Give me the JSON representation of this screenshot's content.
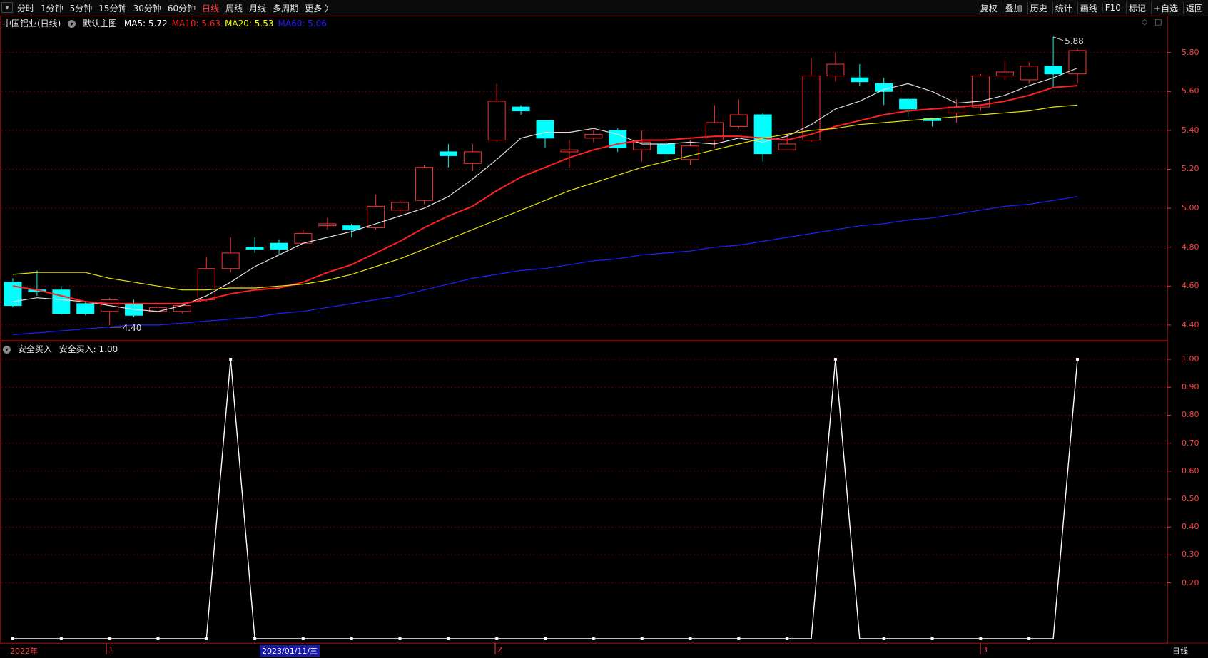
{
  "nav": {
    "lead_icon": "grid-icon",
    "periods": [
      "分时",
      "1分钟",
      "5分钟",
      "15分钟",
      "30分钟",
      "60分钟",
      "日线",
      "周线",
      "月线",
      "多周期",
      "更多 〉"
    ],
    "active": "日线"
  },
  "toolbar": [
    "复权",
    "叠加",
    "历史",
    "统计",
    "画线",
    "F10",
    "标记",
    "+自选",
    "返回"
  ],
  "main_panel": {
    "title": "中国铝业(日线)",
    "indicator": "默认主图",
    "ma": [
      {
        "label": "MA5: 5.72",
        "color": "#ffffff"
      },
      {
        "label": "MA10: 5.63",
        "color": "#ff2020"
      },
      {
        "label": "MA20: 5.53",
        "color": "#ffff00"
      },
      {
        "label": "MA60: 5.06",
        "color": "#2020ff"
      }
    ],
    "high_label": "5.88",
    "low_label": "4.40",
    "icons": [
      "diamond-icon",
      "square-icon"
    ]
  },
  "sub_panel": {
    "title": "安全买入",
    "value_label": "安全买入: 1.00"
  },
  "x_labels": {
    "year": "2022年",
    "m1": "1",
    "cursor": "2023/01/11/三",
    "m2": "2",
    "m3": "3"
  },
  "period_badge": "日线",
  "chart_data": [
    {
      "type": "candlestick",
      "title": "中国铝业(日线)",
      "ylim": [
        4.33,
        5.96
      ],
      "y_ticks": [
        "5.80",
        "5.60",
        "5.40",
        "5.20",
        "5.00",
        "4.80",
        "4.60",
        "4.40"
      ],
      "colors": {
        "up": "#ff3030",
        "down": "#00ffff"
      },
      "candles": [
        [
          4.62,
          4.5,
          4.64,
          4.49
        ],
        [
          4.58,
          4.57,
          4.68,
          4.55
        ],
        [
          4.58,
          4.46,
          4.6,
          4.45
        ],
        [
          4.51,
          4.46,
          4.52,
          4.45
        ],
        [
          4.47,
          4.53,
          4.54,
          4.4
        ],
        [
          4.51,
          4.45,
          4.53,
          4.44
        ],
        [
          4.47,
          4.49,
          4.5,
          4.46
        ],
        [
          4.47,
          4.5,
          4.51,
          4.46
        ],
        [
          4.53,
          4.69,
          4.75,
          4.52
        ],
        [
          4.69,
          4.77,
          4.85,
          4.67
        ],
        [
          4.8,
          4.79,
          4.85,
          4.77
        ],
        [
          4.82,
          4.79,
          4.84,
          4.76
        ],
        [
          4.82,
          4.87,
          4.89,
          4.82
        ],
        [
          4.91,
          4.92,
          4.95,
          4.89
        ],
        [
          4.91,
          4.89,
          4.92,
          4.85
        ],
        [
          4.9,
          5.01,
          5.07,
          4.89
        ],
        [
          4.99,
          5.03,
          5.04,
          4.97
        ],
        [
          5.04,
          5.21,
          5.22,
          5.02
        ],
        [
          5.29,
          5.27,
          5.33,
          5.21
        ],
        [
          5.23,
          5.29,
          5.33,
          5.19
        ],
        [
          5.35,
          5.55,
          5.64,
          5.34
        ],
        [
          5.52,
          5.5,
          5.53,
          5.48
        ],
        [
          5.45,
          5.36,
          5.45,
          5.31
        ],
        [
          5.29,
          5.3,
          5.35,
          5.21
        ],
        [
          5.36,
          5.38,
          5.4,
          5.34
        ],
        [
          5.4,
          5.31,
          5.41,
          5.29
        ],
        [
          5.3,
          5.34,
          5.4,
          5.24
        ],
        [
          5.33,
          5.28,
          5.34,
          5.24
        ],
        [
          5.25,
          5.32,
          5.35,
          5.22
        ],
        [
          5.35,
          5.44,
          5.53,
          5.31
        ],
        [
          5.42,
          5.48,
          5.56,
          5.41
        ],
        [
          5.48,
          5.28,
          5.49,
          5.24
        ],
        [
          5.3,
          5.33,
          5.38,
          5.3
        ],
        [
          5.35,
          5.68,
          5.77,
          5.34
        ],
        [
          5.68,
          5.74,
          5.8,
          5.65
        ],
        [
          5.67,
          5.65,
          5.74,
          5.63
        ],
        [
          5.64,
          5.6,
          5.67,
          5.53
        ],
        [
          5.56,
          5.51,
          5.57,
          5.47
        ],
        [
          5.46,
          5.45,
          5.46,
          5.42
        ],
        [
          5.49,
          5.52,
          5.56,
          5.44
        ],
        [
          5.52,
          5.68,
          5.69,
          5.5
        ],
        [
          5.68,
          5.7,
          5.76,
          5.66
        ],
        [
          5.66,
          5.73,
          5.75,
          5.64
        ],
        [
          5.73,
          5.69,
          5.88,
          5.62
        ],
        [
          5.69,
          5.81,
          5.82,
          5.64
        ]
      ],
      "series": [
        {
          "name": "MA5",
          "color": "#dddddd",
          "values": [
            4.52,
            4.54,
            4.53,
            4.52,
            4.5,
            4.48,
            4.47,
            4.5,
            4.55,
            4.62,
            4.7,
            4.76,
            4.82,
            4.85,
            4.88,
            4.92,
            4.96,
            5.0,
            5.06,
            5.15,
            5.25,
            5.36,
            5.39,
            5.39,
            5.41,
            5.38,
            5.33,
            5.33,
            5.34,
            5.33,
            5.36,
            5.34,
            5.37,
            5.43,
            5.51,
            5.55,
            5.61,
            5.64,
            5.6,
            5.54,
            5.55,
            5.58,
            5.63,
            5.67,
            5.72
          ]
        },
        {
          "name": "MA10",
          "color": "#ff2020",
          "values": [
            4.6,
            4.58,
            4.55,
            4.52,
            4.51,
            4.51,
            4.51,
            4.51,
            4.53,
            4.56,
            4.58,
            4.59,
            4.62,
            4.67,
            4.71,
            4.77,
            4.83,
            4.9,
            4.96,
            5.01,
            5.09,
            5.16,
            5.21,
            5.26,
            5.3,
            5.33,
            5.35,
            5.35,
            5.36,
            5.37,
            5.37,
            5.36,
            5.35,
            5.38,
            5.42,
            5.45,
            5.48,
            5.5,
            5.51,
            5.52,
            5.53,
            5.55,
            5.58,
            5.62,
            5.63
          ]
        },
        {
          "name": "MA20",
          "color": "#e6e600",
          "values": [
            4.66,
            4.67,
            4.67,
            4.67,
            4.64,
            4.62,
            4.6,
            4.58,
            4.58,
            4.59,
            4.59,
            4.6,
            4.61,
            4.63,
            4.66,
            4.7,
            4.74,
            4.79,
            4.84,
            4.89,
            4.94,
            4.99,
            5.04,
            5.09,
            5.13,
            5.17,
            5.21,
            5.24,
            5.27,
            5.3,
            5.33,
            5.36,
            5.38,
            5.4,
            5.41,
            5.43,
            5.44,
            5.45,
            5.46,
            5.47,
            5.48,
            5.49,
            5.5,
            5.52,
            5.53
          ]
        },
        {
          "name": "MA60",
          "color": "#2020ff",
          "values": [
            4.35,
            4.36,
            4.37,
            4.38,
            4.39,
            4.4,
            4.4,
            4.41,
            4.42,
            4.43,
            4.44,
            4.46,
            4.47,
            4.49,
            4.51,
            4.53,
            4.55,
            4.58,
            4.61,
            4.64,
            4.66,
            4.68,
            4.69,
            4.71,
            4.73,
            4.74,
            4.76,
            4.77,
            4.78,
            4.8,
            4.81,
            4.83,
            4.85,
            4.87,
            4.89,
            4.91,
            4.92,
            4.94,
            4.95,
            4.97,
            4.99,
            5.01,
            5.02,
            5.04,
            5.06
          ]
        }
      ]
    },
    {
      "type": "line",
      "title": "安全买入",
      "ylim": [
        0,
        1.0
      ],
      "y_ticks": [
        "1.00",
        "0.90",
        "0.80",
        "0.70",
        "0.60",
        "0.50",
        "0.40",
        "0.30",
        "0.20"
      ],
      "series": [
        {
          "name": "安全买入",
          "color": "#ffffff",
          "values": [
            0,
            0,
            0,
            0,
            0,
            0,
            0,
            0,
            0,
            1,
            0,
            0,
            0,
            0,
            0,
            0,
            0,
            0,
            0,
            0,
            0,
            0,
            0,
            0,
            0,
            0,
            0,
            0,
            0,
            0,
            0,
            0,
            0,
            0,
            1,
            0,
            0,
            0,
            0,
            0,
            0,
            0,
            0,
            0,
            1
          ]
        }
      ]
    }
  ]
}
